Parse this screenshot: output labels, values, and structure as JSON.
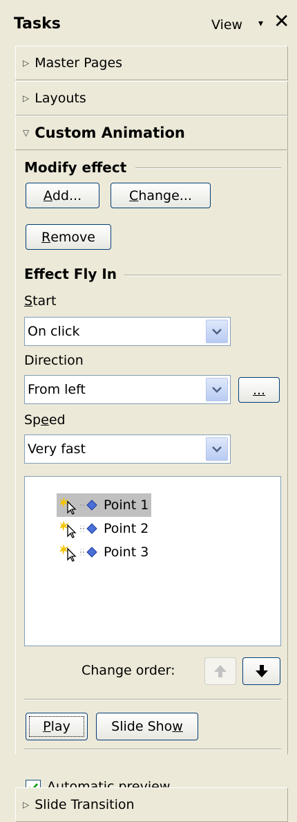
{
  "header": {
    "title": "Tasks",
    "view_label": "View",
    "view_arrow": "▾",
    "close": "✕"
  },
  "sections": {
    "master_pages": "Master Pages",
    "layouts": "Layouts",
    "custom_animation": "Custom Animation",
    "slide_transition": "Slide Transition"
  },
  "modify_effect": {
    "title": "Modify effect",
    "add_button": {
      "prefix": "",
      "accel": "A",
      "suffix": "dd..."
    },
    "change_button": {
      "prefix": "",
      "accel": "C",
      "suffix": "hange..."
    },
    "remove_button": {
      "prefix": "",
      "accel": "R",
      "suffix": "emove"
    }
  },
  "effect": {
    "title": "Effect Fly In",
    "start_label": {
      "prefix": "",
      "accel": "S",
      "suffix": "tart"
    },
    "start_value": "On click",
    "direction_label": "Direction",
    "direction_value": "From left",
    "options_button": "...",
    "speed_label": {
      "prefix": "Sp",
      "accel": "e",
      "suffix": "ed"
    },
    "speed_value": "Very fast"
  },
  "effect_list": {
    "items": [
      {
        "label": "Point 1",
        "selected": true
      },
      {
        "label": "Point 2",
        "selected": false
      },
      {
        "label": "Point 3",
        "selected": false
      }
    ]
  },
  "change_order": {
    "label": "Change order:",
    "up_enabled": false,
    "down_enabled": true
  },
  "playback": {
    "play_button": {
      "prefix": "",
      "accel": "P",
      "suffix": "lay"
    },
    "slideshow_button": {
      "prefix": "Slide Sho",
      "accel": "w",
      "suffix": ""
    }
  },
  "auto_preview": {
    "label": {
      "prefix": "Automatic pre",
      "accel": "v",
      "suffix": "iew"
    },
    "checked": true
  },
  "colors": {
    "background": "#ece9d8",
    "button_border": "#003c74",
    "field_border": "#7f9db9",
    "selection": "#c0c0c0",
    "checkmark": "#21a121"
  }
}
